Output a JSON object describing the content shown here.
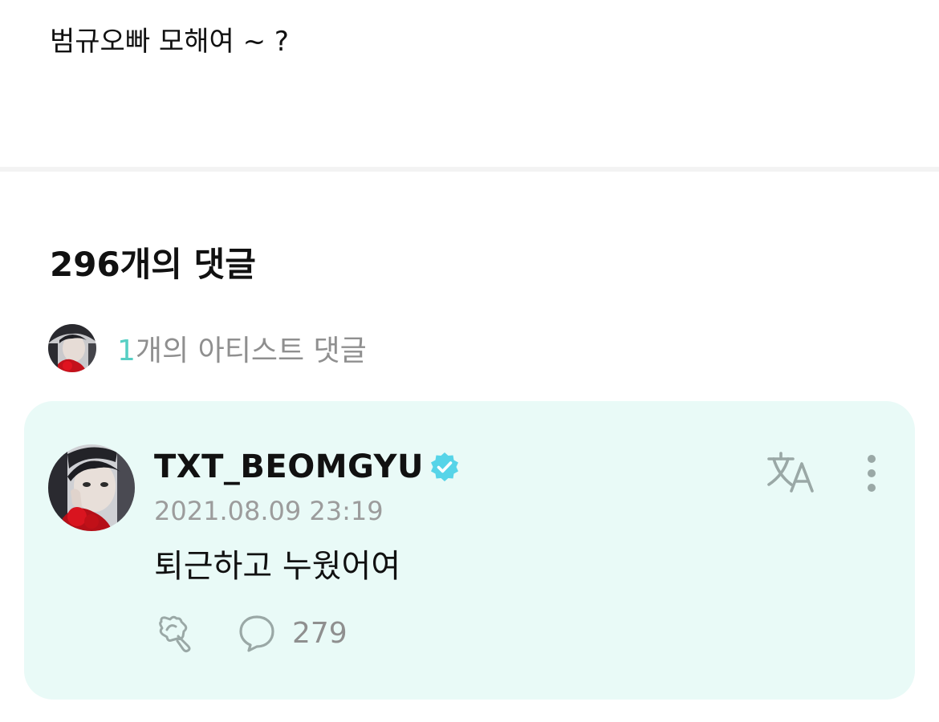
{
  "post": {
    "text": "범규오빠 모해여 ~ ?"
  },
  "comments": {
    "title": "296개의 댓글",
    "artist_summary": {
      "count": "1",
      "suffix": "개의 아티스트 댓글"
    }
  },
  "artist_comment": {
    "username": "TXT_BEOMGYU",
    "timestamp": "2021.08.09 23:19",
    "body": "퇴근하고 누웠어여",
    "reply_count": "279",
    "icons": {
      "verified": "verified-badge-icon",
      "translate": "translate-icon",
      "more": "more-options-icon",
      "like": "like-icon",
      "reply": "reply-icon"
    }
  },
  "colors": {
    "accent": "#57cfc4",
    "card_background": "#e9faf7",
    "muted_text": "#8f8f8f",
    "icon_gray": "#9aa8a6",
    "verified": "#57d4e8"
  }
}
